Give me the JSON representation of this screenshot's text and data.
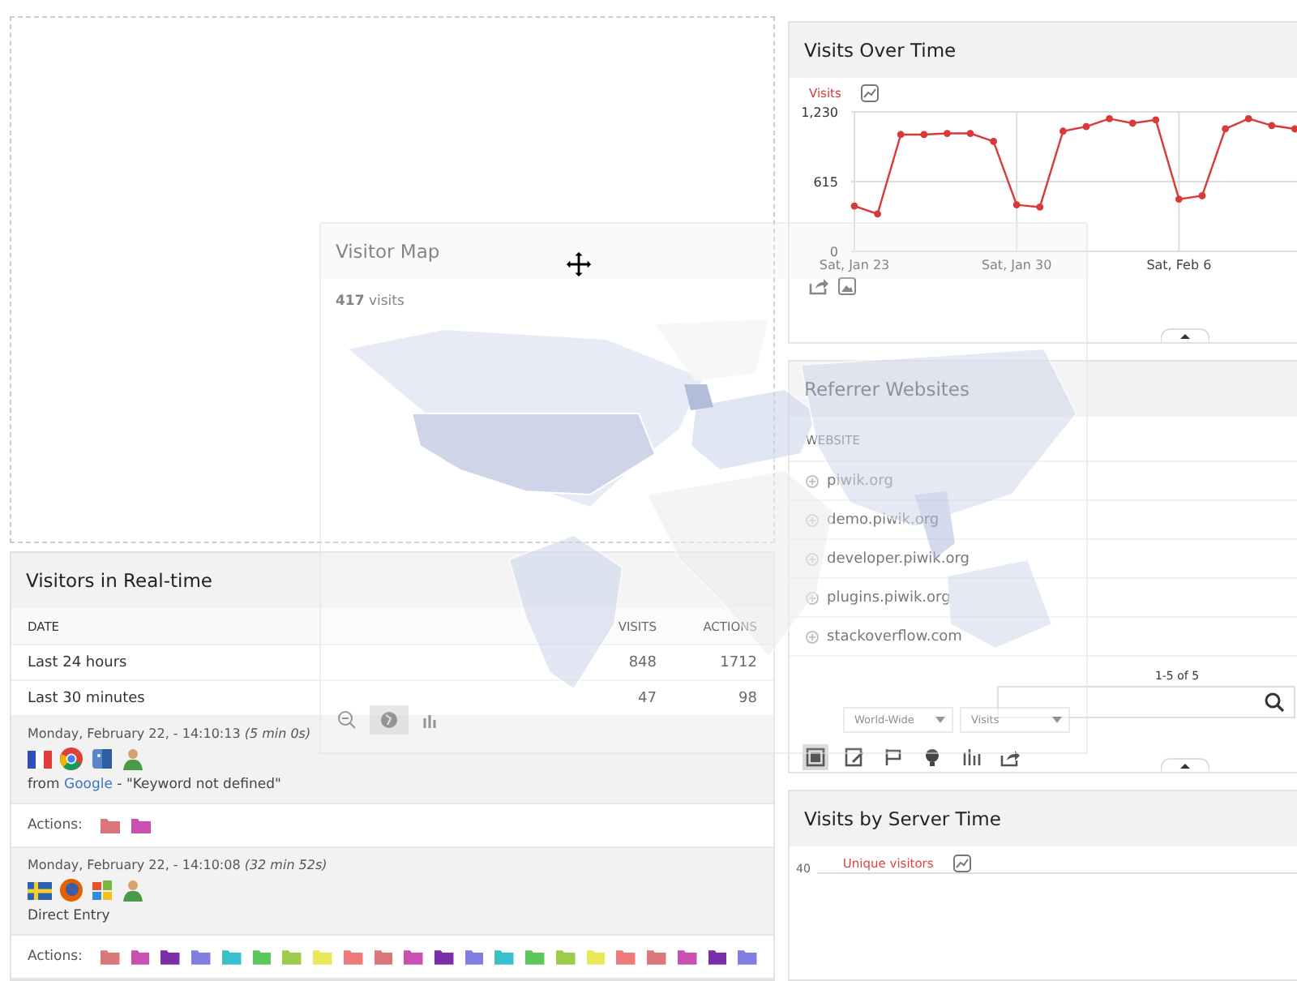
{
  "visits_over_time": {
    "title": "Visits Over Time",
    "chart_data": {
      "type": "line",
      "categories": [
        "Sat, Jan 23",
        null,
        null,
        null,
        null,
        null,
        null,
        "Sat, Jan 30",
        null,
        null,
        null,
        null,
        null,
        null,
        "Sat, Feb 6",
        null,
        null,
        null,
        null,
        null
      ],
      "grid": true,
      "series": [
        {
          "name": "Visits",
          "color": "#d83a3a",
          "marker": true,
          "values": [
            400,
            330,
            1030,
            1030,
            1040,
            1040,
            970,
            410,
            390,
            1060,
            1100,
            1170,
            1130,
            1160,
            460,
            490,
            1080,
            1170,
            1110,
            1080
          ]
        }
      ],
      "ylim": [
        0,
        1230
      ],
      "yticks": [
        0,
        615,
        {
          "value": 1230,
          "label": "1,230"
        }
      ]
    }
  },
  "realtime": {
    "title": "Visitors in Real-time",
    "columns": [
      "DATE",
      "VISITS",
      "ACTIONS"
    ],
    "rows": [
      {
        "date": "Last 24 hours",
        "visits": "848",
        "actions": "1712"
      },
      {
        "date": "Last 30 minutes",
        "visits": "47",
        "actions": "98"
      }
    ],
    "visits": [
      {
        "time": "Monday, February 22, - 14:10:13",
        "duration": "(5 min 0s)",
        "icons": [
          {
            "kind": "flag_fr"
          },
          {
            "kind": "chrome"
          },
          {
            "kind": "mac"
          },
          {
            "kind": "visitor"
          }
        ],
        "referrer_prefix": "from ",
        "referrer_link": "Google",
        "referrer_suffix": " - \"Keyword not defined\"",
        "actions_label": "Actions:",
        "actions": [
          {
            "color": "#d9777a"
          },
          {
            "color": "#c94fb0"
          }
        ]
      },
      {
        "time": "Monday, February 22, - 14:10:08",
        "duration": "(32 min 52s)",
        "icons": [
          {
            "kind": "flag_se"
          },
          {
            "kind": "firefox"
          },
          {
            "kind": "windows"
          },
          {
            "kind": "visitor"
          }
        ],
        "referrer_prefix": "Direct Entry",
        "actions_label": "Actions:",
        "actions": [
          {
            "color": "#d9777a"
          },
          {
            "color": "#c94fb0"
          },
          {
            "color": "#7a2fa8"
          },
          {
            "color": "#7f7fe0"
          },
          {
            "color": "#3ac0cc"
          },
          {
            "color": "#5cc85c"
          },
          {
            "color": "#9ccc4a"
          },
          {
            "color": "#e8e85a"
          },
          {
            "color": "#f07a7a"
          },
          {
            "color": "#d9777a"
          },
          {
            "color": "#c94fb0"
          },
          {
            "color": "#7a2fa8"
          },
          {
            "color": "#7f7fe0"
          },
          {
            "color": "#3ac0cc"
          },
          {
            "color": "#5cc85c"
          },
          {
            "color": "#9ccc4a"
          },
          {
            "color": "#e8e85a"
          },
          {
            "color": "#f07a7a"
          },
          {
            "color": "#d9777a"
          },
          {
            "color": "#c94fb0"
          },
          {
            "color": "#7a2fa8"
          },
          {
            "color": "#7f7fe0"
          }
        ]
      }
    ]
  },
  "referrers": {
    "title": "Referrer Websites",
    "column": "WEBSITE",
    "rows": [
      "piwik.org",
      "demo.piwik.org",
      "developer.piwik.org",
      "plugins.piwik.org",
      "stackoverflow.com"
    ],
    "pagination": "1-5 of 5",
    "toolbar": [
      {
        "kind": "table",
        "selected": true
      },
      {
        "kind": "table_edit",
        "selected": false
      },
      {
        "kind": "flag",
        "selected": false
      },
      {
        "kind": "bulb",
        "selected": false
      },
      {
        "kind": "bars",
        "selected": false
      },
      {
        "kind": "export",
        "selected": false
      }
    ]
  },
  "visitor_map": {
    "title": "Visitor Map",
    "summary": "**417** visits",
    "region": "World-Wide",
    "metric": "Visits",
    "tools": [
      {
        "kind": "zoom_out",
        "selected": false
      },
      {
        "kind": "globe",
        "selected": true
      },
      {
        "kind": "bars",
        "selected": false
      }
    ]
  },
  "server_time": {
    "title": "Visits by Server Time",
    "legend": "Unique visitors",
    "ytick": "40"
  }
}
